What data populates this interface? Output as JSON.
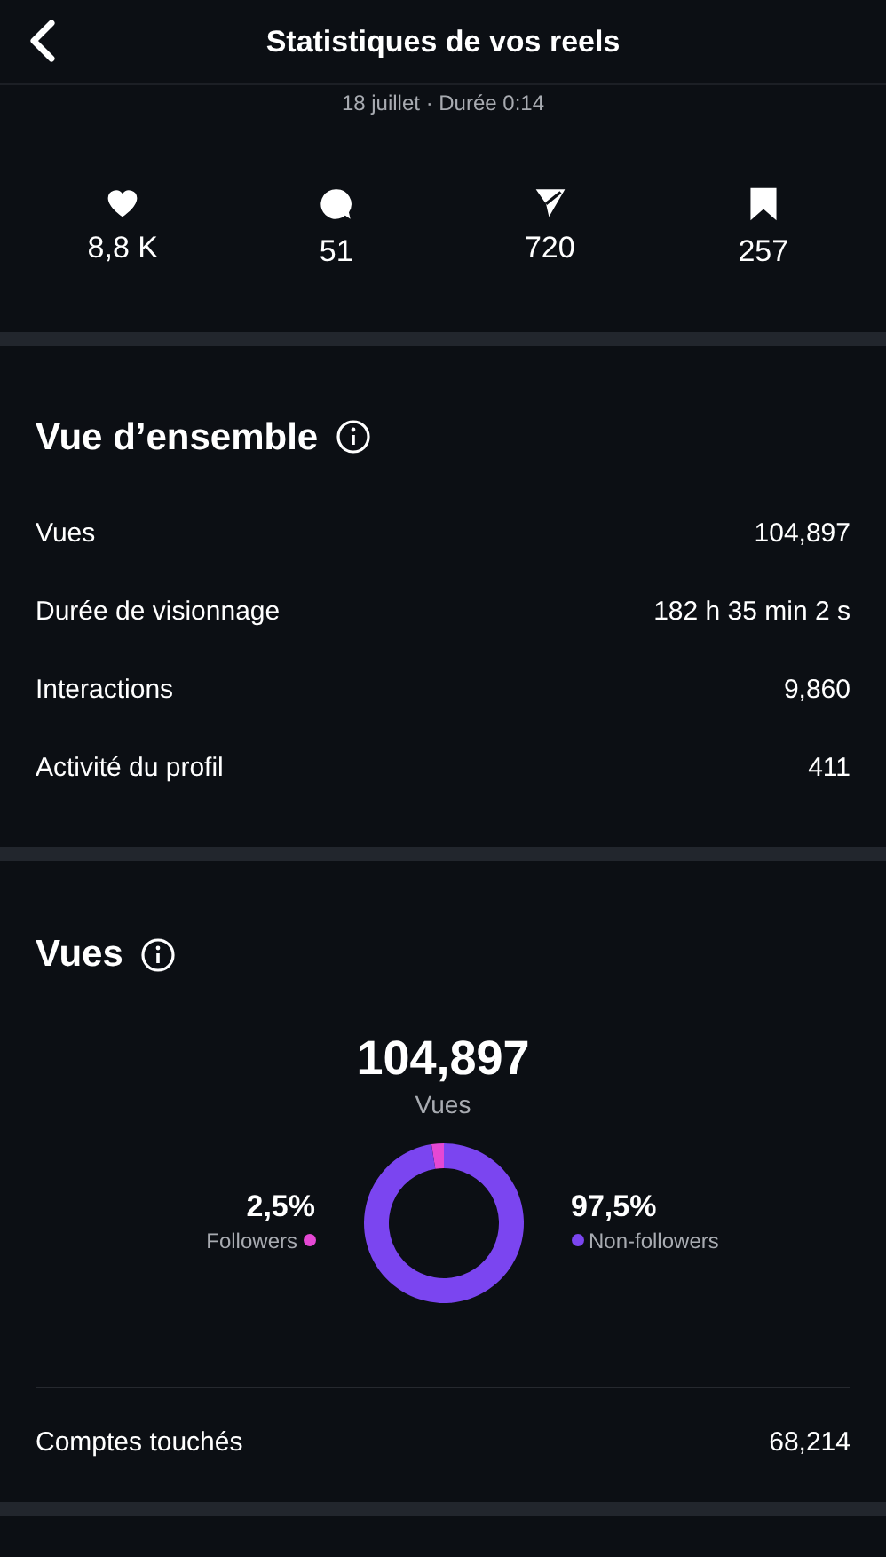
{
  "header": {
    "title": "Statistiques de vos reels",
    "subtitle": "18 juillet · Durée 0:14"
  },
  "engagement": [
    {
      "kind": "likes",
      "value": "8,8 K"
    },
    {
      "kind": "comments",
      "value": "51"
    },
    {
      "kind": "shares",
      "value": "720"
    },
    {
      "kind": "saves",
      "value": "257"
    }
  ],
  "overview": {
    "title": "Vue d’ensemble",
    "rows": [
      {
        "label": "Vues",
        "value": "104,897"
      },
      {
        "label": "Durée de visionnage",
        "value": "182 h 35 min 2 s"
      },
      {
        "label": "Interactions",
        "value": "9,860"
      },
      {
        "label": "Activité du profil",
        "value": "411"
      }
    ]
  },
  "views": {
    "title": "Vues",
    "total": "104,897",
    "total_label": "Vues",
    "legend": [
      {
        "percent": "2,5%",
        "color": "#e548d4"
      },
      {
        "percent": "97,5%",
        "color": "#7b45f0"
      }
    ],
    "chart_data": {
      "type": "donut",
      "categories": [
        "Followers",
        "Non-followers"
      ],
      "values": [
        2.5,
        97.5
      ]
    },
    "footer_row": {
      "label": "Comptes touchés",
      "value": "68,214"
    }
  }
}
